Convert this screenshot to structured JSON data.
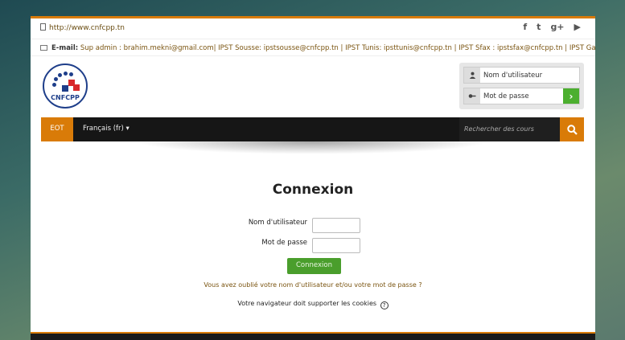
{
  "topbar": {
    "url": "http://www.cnfcpp.tn",
    "social": [
      {
        "icon": "facebook-icon",
        "glyph": "f"
      },
      {
        "icon": "twitter-icon",
        "glyph": "t"
      },
      {
        "icon": "google-plus-icon",
        "glyph": "g+"
      },
      {
        "icon": "youtube-icon",
        "glyph": "▶"
      }
    ]
  },
  "emailbar": {
    "label": "E-mail:",
    "text": "Sup admin : brahim.mekni@gmail.com| IPST Sousse: ipstsousse@cnfcpp.tn | IPST Tunis: ipsttunis@cnfcpp.tn | IPST Sfax : ipstsfax@cnfcpp.tn | IPST Gabès: ipstgabes@cnfcpp.tn"
  },
  "logo": {
    "text": "CNFCPP"
  },
  "loginbox": {
    "username_placeholder": "Nom d'utilisateur",
    "password_placeholder": "Mot de passe",
    "go": "›"
  },
  "navbar": {
    "brand": "EOT",
    "language": "Français (fr) ▾",
    "search_placeholder": "Rechercher des cours"
  },
  "main": {
    "title": "Connexion",
    "username_label": "Nom d'utilisateur",
    "password_label": "Mot de passe",
    "login_button": "Connexion",
    "forgot_link": "Vous avez oublié votre nom d'utilisateur et/ou votre mot de passe ?",
    "cookies_text": "Votre navigateur doit supporter les cookies",
    "help": "?"
  },
  "colors": {
    "accent": "#d97b08",
    "success": "#4a9e2c",
    "dark": "#161616"
  }
}
